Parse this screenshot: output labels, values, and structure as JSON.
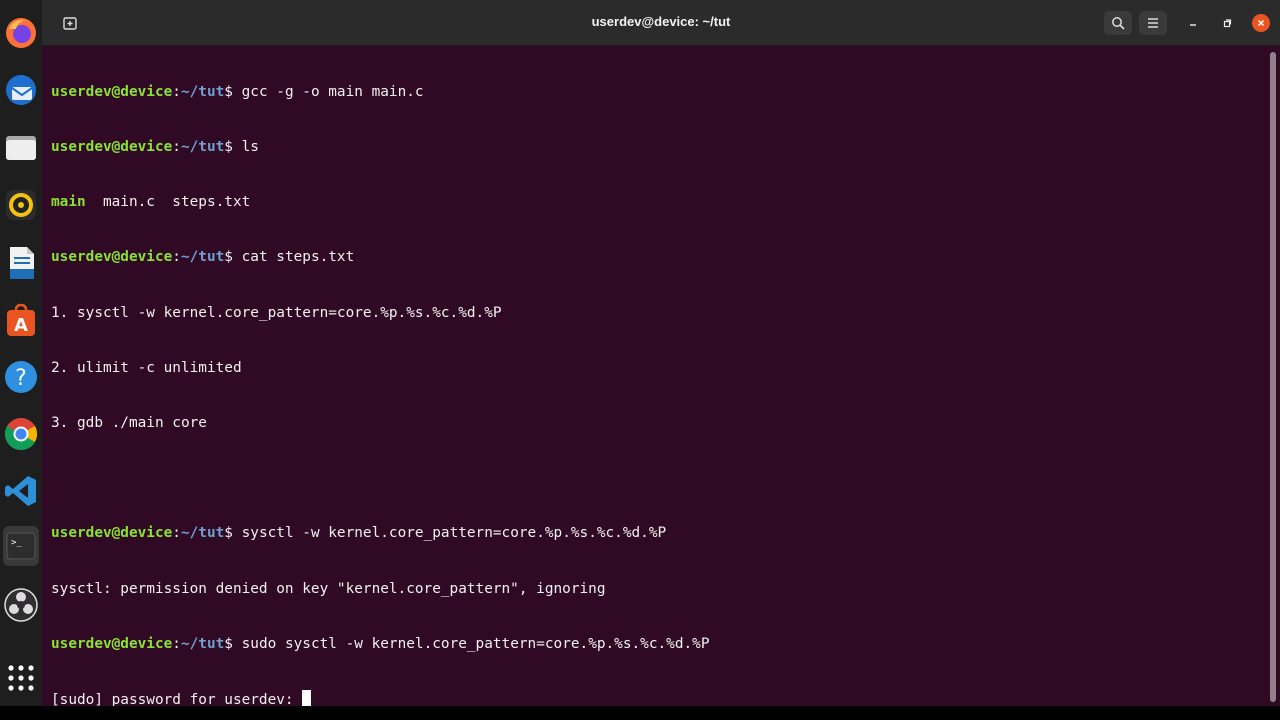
{
  "window": {
    "title": "userdev@device: ~/tut"
  },
  "dock": {
    "items": [
      {
        "name": "firefox-icon"
      },
      {
        "name": "thunderbird-icon"
      },
      {
        "name": "files-icon"
      },
      {
        "name": "rhythmbox-icon"
      },
      {
        "name": "libreoffice-writer-icon"
      },
      {
        "name": "app-center-icon",
        "glyph": "A"
      },
      {
        "name": "help-icon",
        "glyph": "?"
      },
      {
        "name": "chrome-icon"
      },
      {
        "name": "vscode-icon"
      },
      {
        "name": "terminal-icon",
        "glyph": ">_"
      },
      {
        "name": "obs-icon"
      },
      {
        "name": "show-apps-icon"
      }
    ]
  },
  "prompt": {
    "user": "userdev@device",
    "colon": ":",
    "path": "~/tut",
    "dollar": "$"
  },
  "terminal": {
    "cmd1": " gcc -g -o main main.c",
    "cmd2": " ls",
    "ls_exec": "main",
    "ls_rest": "  main.c  steps.txt",
    "cmd3": " cat steps.txt",
    "steps1": "1. sysctl -w kernel.core_pattern=core.%p.%s.%c.%d.%P",
    "steps2": "2. ulimit -c unlimited",
    "steps3": "3. gdb ./main core",
    "cmd4": " sysctl -w kernel.core_pattern=core.%p.%s.%c.%d.%P",
    "err": "sysctl: permission denied on key \"kernel.core_pattern\", ignoring",
    "cmd5": " sudo sysctl -w kernel.core_pattern=core.%p.%s.%c.%d.%P",
    "sudo_prompt": "[sudo] password for userdev: "
  },
  "colors": {
    "terminal_bg": "#300a24",
    "prompt_user": "#8ae234",
    "prompt_path": "#729fcf",
    "close_button": "#e95420"
  }
}
